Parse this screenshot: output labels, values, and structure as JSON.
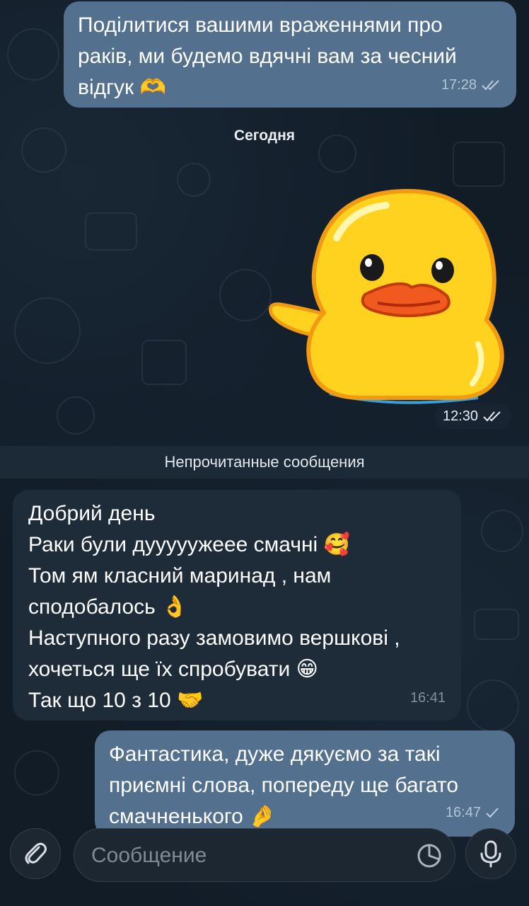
{
  "messages": [
    {
      "direction": "outgoing",
      "lines": [
        "Поділитися вашими враженнями про",
        "раків, ми будемо вдячні вам за чесний",
        "відгук 🫶"
      ],
      "time": "17:28",
      "status": "read"
    },
    {
      "direction": "outgoing",
      "type": "sticker",
      "sticker": "duck-waving",
      "time": "12:30",
      "status": "read"
    },
    {
      "direction": "incoming",
      "lines": [
        "Добрий день",
        "Раки були дууууужеее смачні 🥰",
        "Том ям класний маринад , нам",
        "сподобалось 👌",
        "Наступного разу замовимо вершкові ,",
        "хочеться ще їх спробувати 😁",
        "Так що 10 з 10 🤝"
      ],
      "time": "16:41"
    },
    {
      "direction": "outgoing",
      "lines": [
        "Фантастика, дуже дякуємо за такі",
        "приємні слова, попереду ще багато",
        "смачненького 🤌"
      ],
      "time": "16:47",
      "status": "sent"
    }
  ],
  "date_separator": "Сегодня",
  "unread_separator": "Непрочитанные сообщения",
  "composer": {
    "placeholder": "Сообщение",
    "attach_icon": "paperclip-icon",
    "sticker_icon": "sticker-icon",
    "mic_icon": "microphone-icon"
  },
  "colors": {
    "background": "#111c27",
    "outgoing_bubble": "#53708f",
    "incoming_bubble": "#1e2c3a",
    "duck_yellow": "#ffd21f",
    "duck_beak": "#f05a1e"
  }
}
